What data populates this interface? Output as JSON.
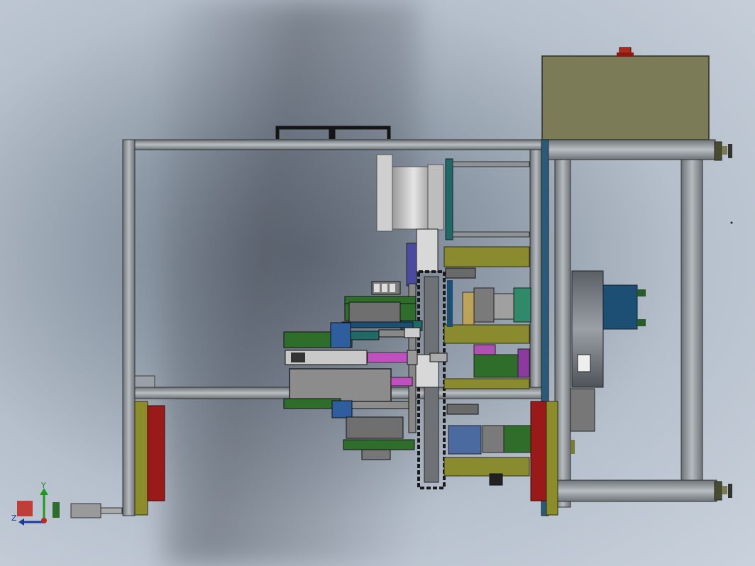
{
  "viewport": {
    "name": "solidworks-3d-viewport",
    "background": "#a4afbc"
  },
  "triad": {
    "x_label": "",
    "y_label": "Y",
    "z_label": "Z",
    "colors": {
      "x": "#c0261c",
      "y": "#1c9a1c",
      "z": "#1a3a9a"
    }
  },
  "colors": {
    "frame": "#8a8f93",
    "frame_edge": "#3a3d40",
    "cabinet": "#7f7f5c",
    "olive": "#8a8a2a",
    "teal": "#1f6a66",
    "motor": "#6a7076",
    "motor_blue": "#1d4e74",
    "red": "#9a1a1a",
    "green": "#2f6e2a",
    "grey_block": "#8a8a8a",
    "magenta": "#b050b0"
  }
}
